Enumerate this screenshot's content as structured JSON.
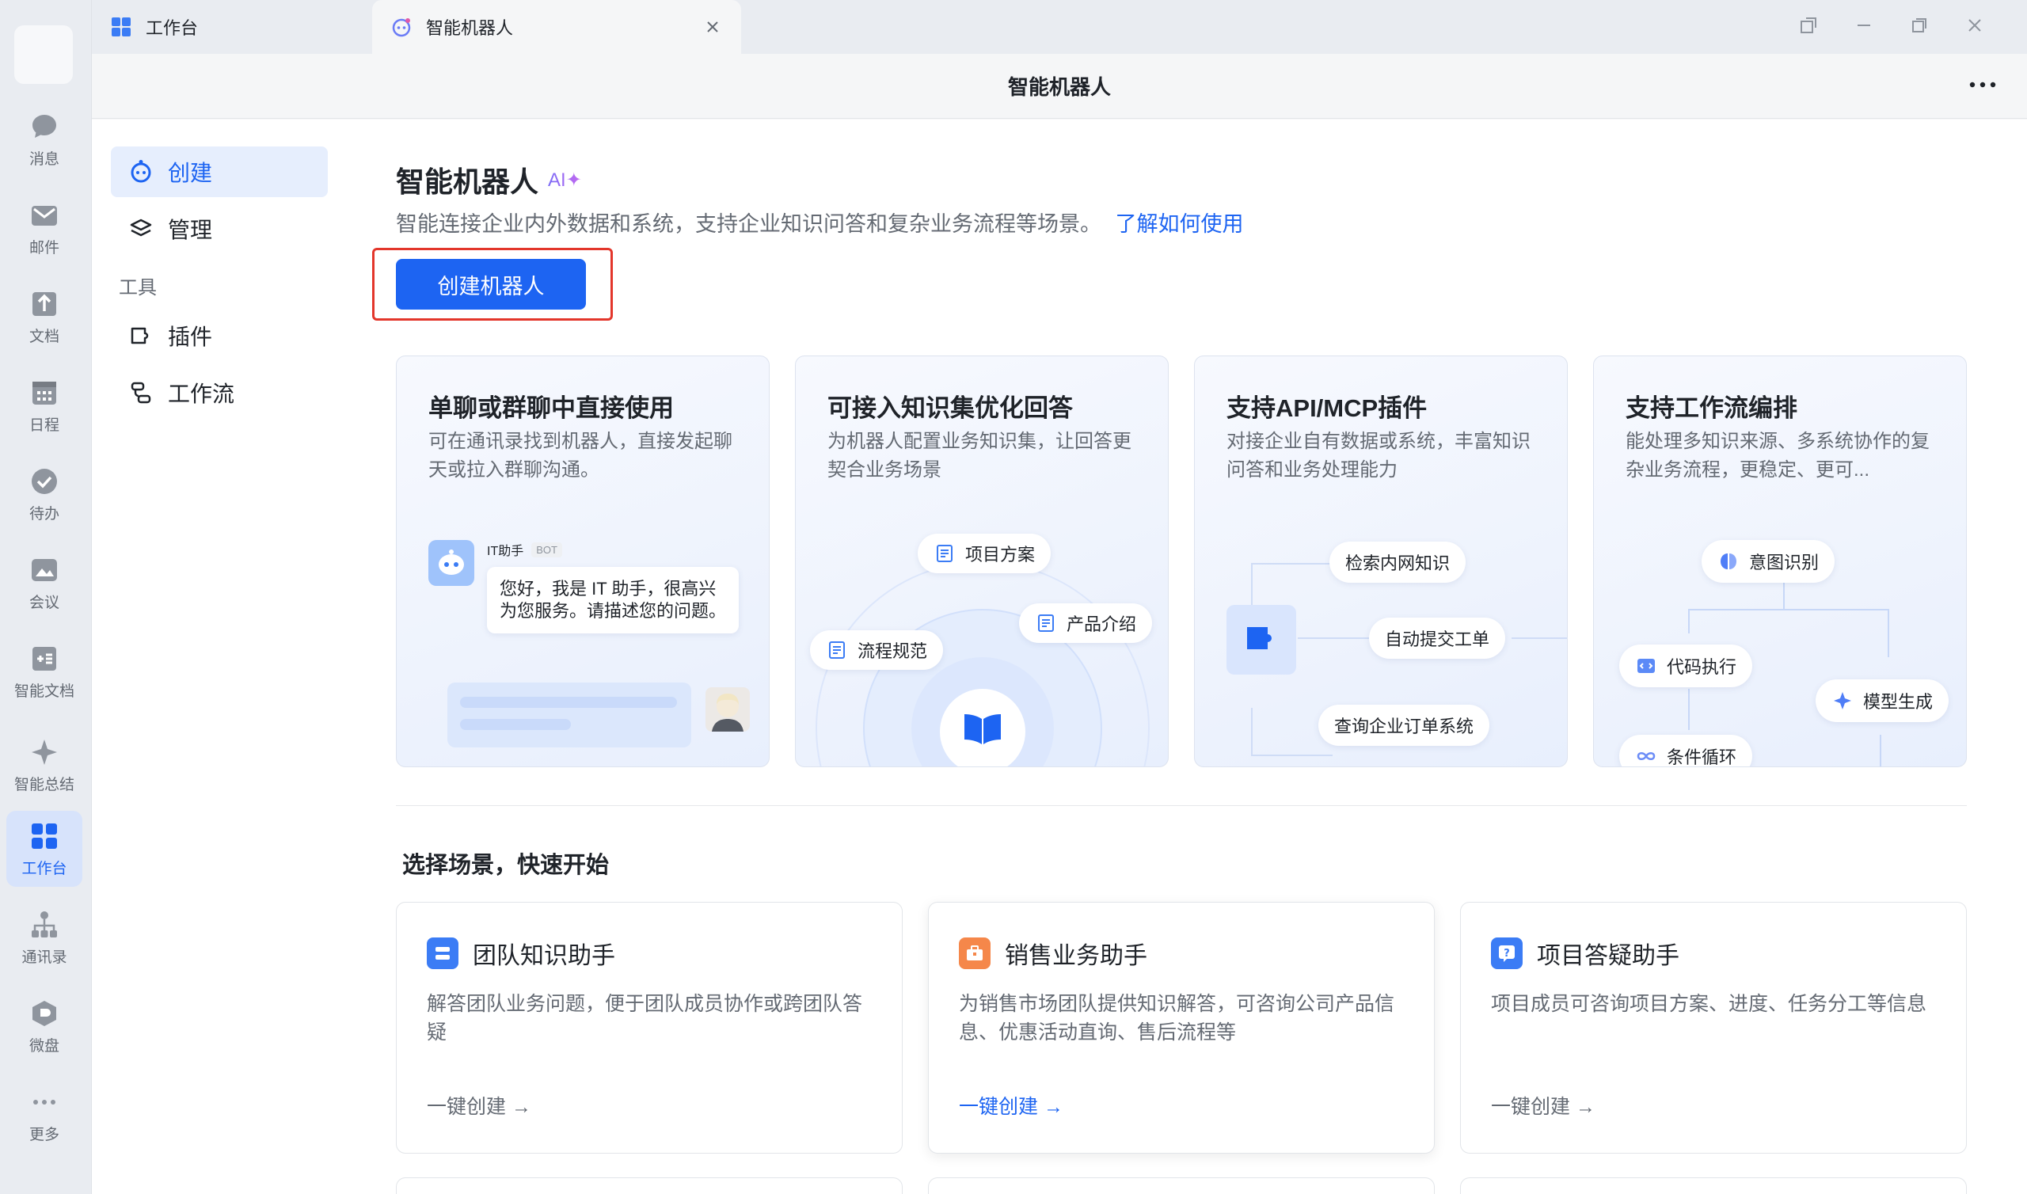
{
  "rail": {
    "items": [
      {
        "label": "消息",
        "icon": "chat-bubble-icon"
      },
      {
        "label": "邮件",
        "icon": "mail-icon"
      },
      {
        "label": "文档",
        "icon": "document-icon"
      },
      {
        "label": "日程",
        "icon": "calendar-icon"
      },
      {
        "label": "待办",
        "icon": "check-circle-icon"
      },
      {
        "label": "会议",
        "icon": "meeting-icon"
      },
      {
        "label": "智能文档",
        "icon": "smart-doc-icon"
      },
      {
        "label": "智能总结",
        "icon": "sparkle-icon"
      },
      {
        "label": "工作台",
        "icon": "grid-icon"
      },
      {
        "label": "通讯录",
        "icon": "org-chart-icon"
      },
      {
        "label": "微盘",
        "icon": "drive-icon"
      },
      {
        "label": "更多",
        "icon": "more-dots-icon"
      }
    ],
    "active": "工作台"
  },
  "tabs": [
    {
      "label": "工作台"
    },
    {
      "label": "智能机器人"
    }
  ],
  "header": {
    "title": "智能机器人"
  },
  "sidenav": {
    "create": "创建",
    "manage": "管理",
    "tools_group": "工具",
    "plugins": "插件",
    "workflow": "工作流"
  },
  "main": {
    "title": "智能机器人",
    "ai_badge": "AI✦",
    "description": "智能连接企业内外数据和系统，支持企业知识问答和复杂业务流程等场景。",
    "learn_link": "了解如何使用",
    "create_button": "创建机器人"
  },
  "features": [
    {
      "title": "单聊或群聊中直接使用",
      "desc": "可在通讯录找到机器人，直接发起聊天或拉入群聊沟通。",
      "bot_name": "IT助手",
      "bot_tag": "BOT",
      "bot_message": "您好，我是 IT 助手，很高兴为您服务。请描述您的问题。"
    },
    {
      "title": "可接入知识集优化回答",
      "desc": "为机器人配置业务知识集，让回答更契合业务场景",
      "pills": [
        "项目方案",
        "产品介绍",
        "流程规范"
      ]
    },
    {
      "title": "支持API/MCP插件",
      "desc": "对接企业自有数据或系统，丰富知识问答和业务处理能力",
      "pills": [
        "检索内网知识",
        "自动提交工单",
        "查询企业订单系统"
      ]
    },
    {
      "title": "支持工作流编排",
      "desc": "能处理多知识来源、多系统协作的复杂业务流程，更稳定、更可...",
      "pills": [
        "意图识别",
        "代码执行",
        "模型生成",
        "条件循环"
      ]
    }
  ],
  "scenes_title": "选择场景，快速开始",
  "scenes": [
    {
      "title": "团队知识助手",
      "desc": "解答团队业务问题，便于团队成员协作或跨团队答疑",
      "action": "一键创建 →",
      "color": "#3b7cf5"
    },
    {
      "title": "销售业务助手",
      "desc": "为销售市场团队提供知识解答，可咨询公司产品信息、优惠活动直询、售后流程等",
      "action": "一键创建 →",
      "color": "#f5874a"
    },
    {
      "title": "项目答疑助手",
      "desc": "项目成员可咨询项目方案、进度、任务分工等信息",
      "action": "一键创建 →",
      "color": "#3b7cf5"
    }
  ],
  "colors": {
    "accent": "#1d64f2",
    "highlight": "#e3362b"
  }
}
